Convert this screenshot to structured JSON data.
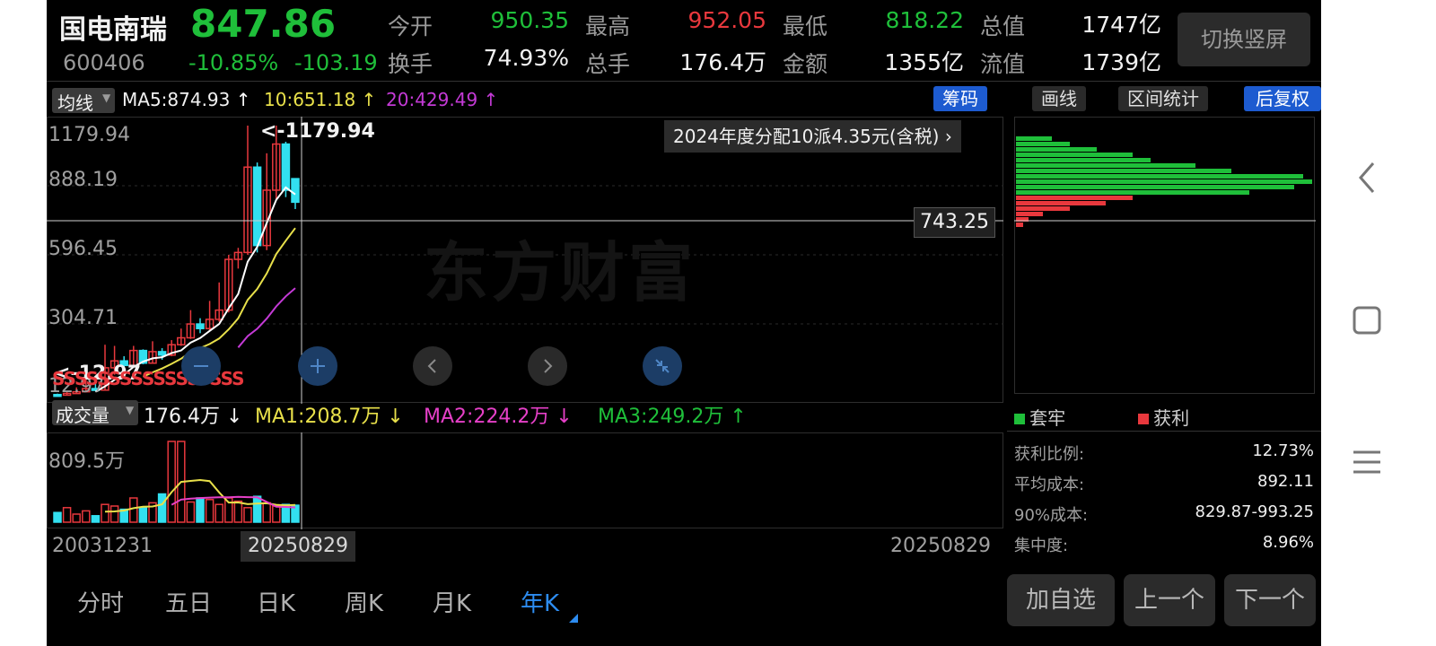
{
  "stock": {
    "name": "国电南瑞",
    "price": "847.86",
    "code": "600406",
    "change_pct": "-10.85%",
    "change_abs": "-103.19"
  },
  "quote": {
    "open_label": "今开",
    "open": "950.35",
    "high_label": "最高",
    "high": "952.05",
    "low_label": "最低",
    "low": "818.22",
    "mktcap_label": "总值",
    "mktcap": "1747亿",
    "turnover_label": "换手",
    "turnover": "74.93%",
    "volume_label": "总手",
    "volume": "176.4万",
    "amount_label": "金额",
    "amount": "1355亿",
    "float_label": "流值",
    "float": "1739亿"
  },
  "switch_label": "切换竖屏",
  "indicator": {
    "selector": "均线",
    "ma5": "MA5:874.93",
    "ma10": "10:651.18",
    "ma20": "20:429.49"
  },
  "toolbar": {
    "chips": "筹码",
    "draw": "画线",
    "range_stats": "区间统计",
    "adjust": "后复权"
  },
  "chart": {
    "y_labels": [
      "1179.94",
      "888.19",
      "596.45",
      "304.71",
      "12.97"
    ],
    "max_note": "<-1179.94",
    "min_note": "<-12.97",
    "dividend": "2024年度分配10派4.35元(含税) ›",
    "crosshair_price": "743.25",
    "watermark": "东方财富",
    "s_marker": "SSSSSSSSSSSSSSSSS"
  },
  "volume": {
    "selector": "成交量",
    "value": "176.4万",
    "ma1": "MA1:208.7万",
    "ma2": "MA2:224.2万",
    "ma3": "MA3:249.2万",
    "y_label": "809.5万"
  },
  "dates": {
    "start": "20031231",
    "cursor": "20250829",
    "end": "20250829"
  },
  "legend": {
    "trapped": "套牢",
    "profit": "获利"
  },
  "stats": [
    {
      "label": "获利比例:",
      "value": "12.73%"
    },
    {
      "label": "平均成本:",
      "value": "892.11"
    },
    {
      "label": "90%成本:",
      "value": "829.87-993.25"
    },
    {
      "label": "集中度:",
      "value": "8.96%"
    }
  ],
  "tabs": [
    "分时",
    "五日",
    "日K",
    "周K",
    "月K",
    "年K"
  ],
  "active_tab": 5,
  "buttons": {
    "add_watch": "加自选",
    "prev": "上一个",
    "next": "下一个"
  },
  "colors": {
    "up": "#e8383d",
    "down": "#1fbf3a",
    "cyan": "#32e0f0",
    "accent": "#2d8cf0",
    "ma5": "#ffffff",
    "ma10": "#e8e04a",
    "ma20": "#c43ad6"
  }
}
